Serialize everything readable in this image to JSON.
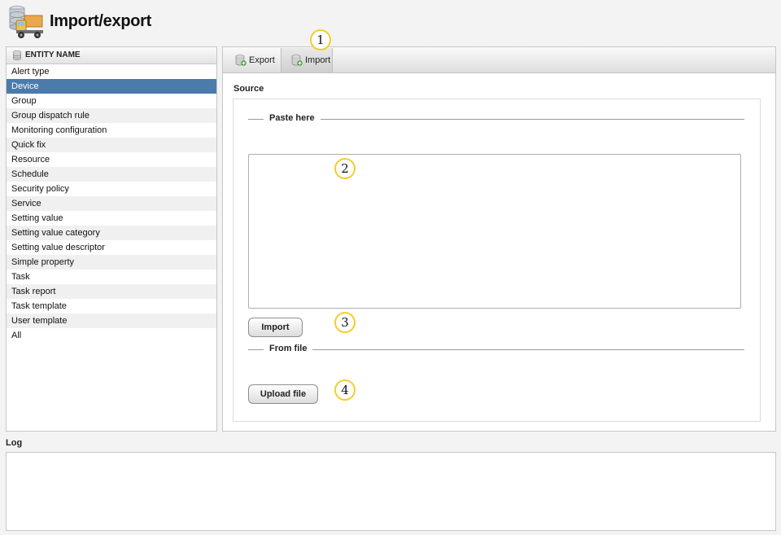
{
  "page": {
    "title": "Import/export"
  },
  "entities": {
    "header": "ENTITY NAME",
    "selected": "Device",
    "items": [
      "Alert type",
      "Device",
      "Group",
      "Group dispatch rule",
      "Monitoring configuration",
      "Quick fix",
      "Resource",
      "Schedule",
      "Security policy",
      "Service",
      "Setting value",
      "Setting value category",
      "Setting value descriptor",
      "Simple property",
      "Task",
      "Task report",
      "Task template",
      "User template",
      "All"
    ]
  },
  "tabs": {
    "export": "Export",
    "import": "Import",
    "active": "Import"
  },
  "source": {
    "label": "Source",
    "paste_legend": "Paste here",
    "paste_value": "",
    "import_button": "Import",
    "file_legend": "From file",
    "upload_button": "Upload file"
  },
  "callouts": {
    "c1": "1",
    "c2": "2",
    "c3": "3",
    "c4": "4"
  },
  "log": {
    "label": "Log",
    "content": ""
  },
  "colors": {
    "selection": "#4a7bab",
    "callout_border": "#f2cf2e",
    "background": "#f3f3f3"
  },
  "icons": {
    "app": "truck-database-icon",
    "entity_header": "database-icon",
    "export_tab": "database-export-icon",
    "import_tab": "database-import-icon"
  }
}
